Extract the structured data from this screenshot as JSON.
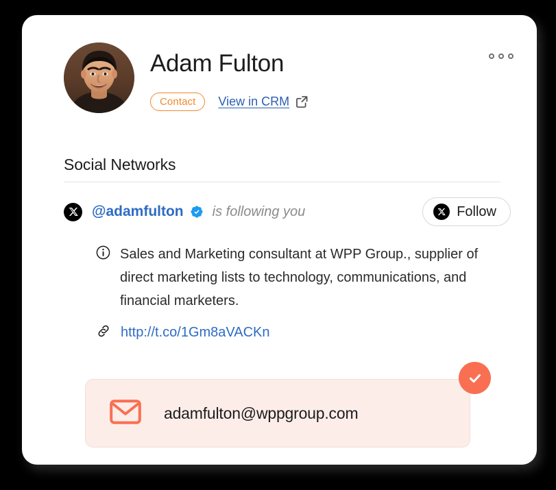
{
  "card": {
    "header": {
      "avatar_alt": "avatar-photo",
      "name": "Adam Fulton",
      "badge_label": "Contact",
      "crm_link_label": "View in CRM",
      "crm_link_icon": "external-link-icon",
      "more_options_icon": "kebab-menu-icon"
    },
    "section": {
      "title": "Social Networks"
    },
    "social": {
      "network_icon": "x-twitter-icon",
      "handle": "@adamfulton",
      "verified_icon": "verified-badge-icon",
      "relationship_status": "is following you",
      "follow_button": {
        "icon": "x-twitter-icon",
        "label": "Follow"
      },
      "bio": {
        "icon": "info-circle-icon",
        "text": "Sales and Marketing consultant at WPP Group., supplier of direct marketing lists to technology, communications, and financial marketers."
      },
      "url": {
        "icon": "link-chain-icon",
        "text": "http://t.co/1Gm8aVACKn"
      }
    },
    "email": {
      "icon": "envelope-icon",
      "address": "adamfulton@wppgroup.com",
      "status_icon": "check-circle-icon"
    }
  },
  "colors": {
    "page_background": "#000000",
    "card_background": "#FFFFFF",
    "badge_orange": "#F2882B",
    "link_blue": "#2D5FB3",
    "handle_blue": "#2D6BC4",
    "verified_blue": "#1D9BF0",
    "muted_gray": "#8A8A8A",
    "email_box_background": "#FDEDE9",
    "email_accent": "#F96F52",
    "divider": "#E3E3E3"
  }
}
